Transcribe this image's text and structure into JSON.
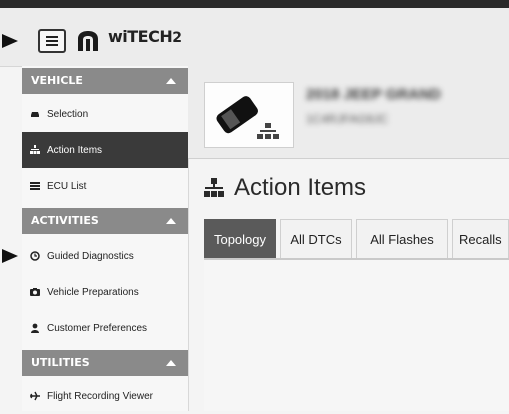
{
  "header": {
    "menu_icon": "hamburger-icon",
    "brand_logo": "mopar-logo",
    "app_logo_text": "wiTECH",
    "app_logo_version": "2"
  },
  "sidebar": {
    "sections": [
      {
        "title": "VEHICLE",
        "items": [
          {
            "label": "Selection",
            "icon": "car-icon"
          },
          {
            "label": "Action Items",
            "icon": "sitemap-icon",
            "active": true
          },
          {
            "label": "ECU List",
            "icon": "list-icon"
          }
        ]
      },
      {
        "title": "ACTIVITIES",
        "items": [
          {
            "label": "Guided Diagnostics",
            "icon": "clock-icon"
          },
          {
            "label": "Vehicle Preparations",
            "icon": "camera-icon"
          },
          {
            "label": "Customer Preferences",
            "icon": "user-icon"
          }
        ]
      },
      {
        "title": "UTILITIES",
        "items": [
          {
            "label": "Flight Recording Viewer",
            "icon": "plane-icon"
          }
        ]
      }
    ]
  },
  "vehicle": {
    "name_line": "2018 JEEP GRAND",
    "vin_line": "1C4RJFAG9JC"
  },
  "page": {
    "title": "Action Items",
    "title_icon": "sitemap-icon"
  },
  "tabs": [
    {
      "label": "Topology",
      "active": true
    },
    {
      "label": "All DTCs"
    },
    {
      "label": "All Flashes"
    },
    {
      "label": "Recalls"
    }
  ],
  "colors": {
    "section_header_bg": "#8a8a8a",
    "active_item_bg": "#3a3a3a",
    "active_tab_bg": "#5a5a5a"
  }
}
